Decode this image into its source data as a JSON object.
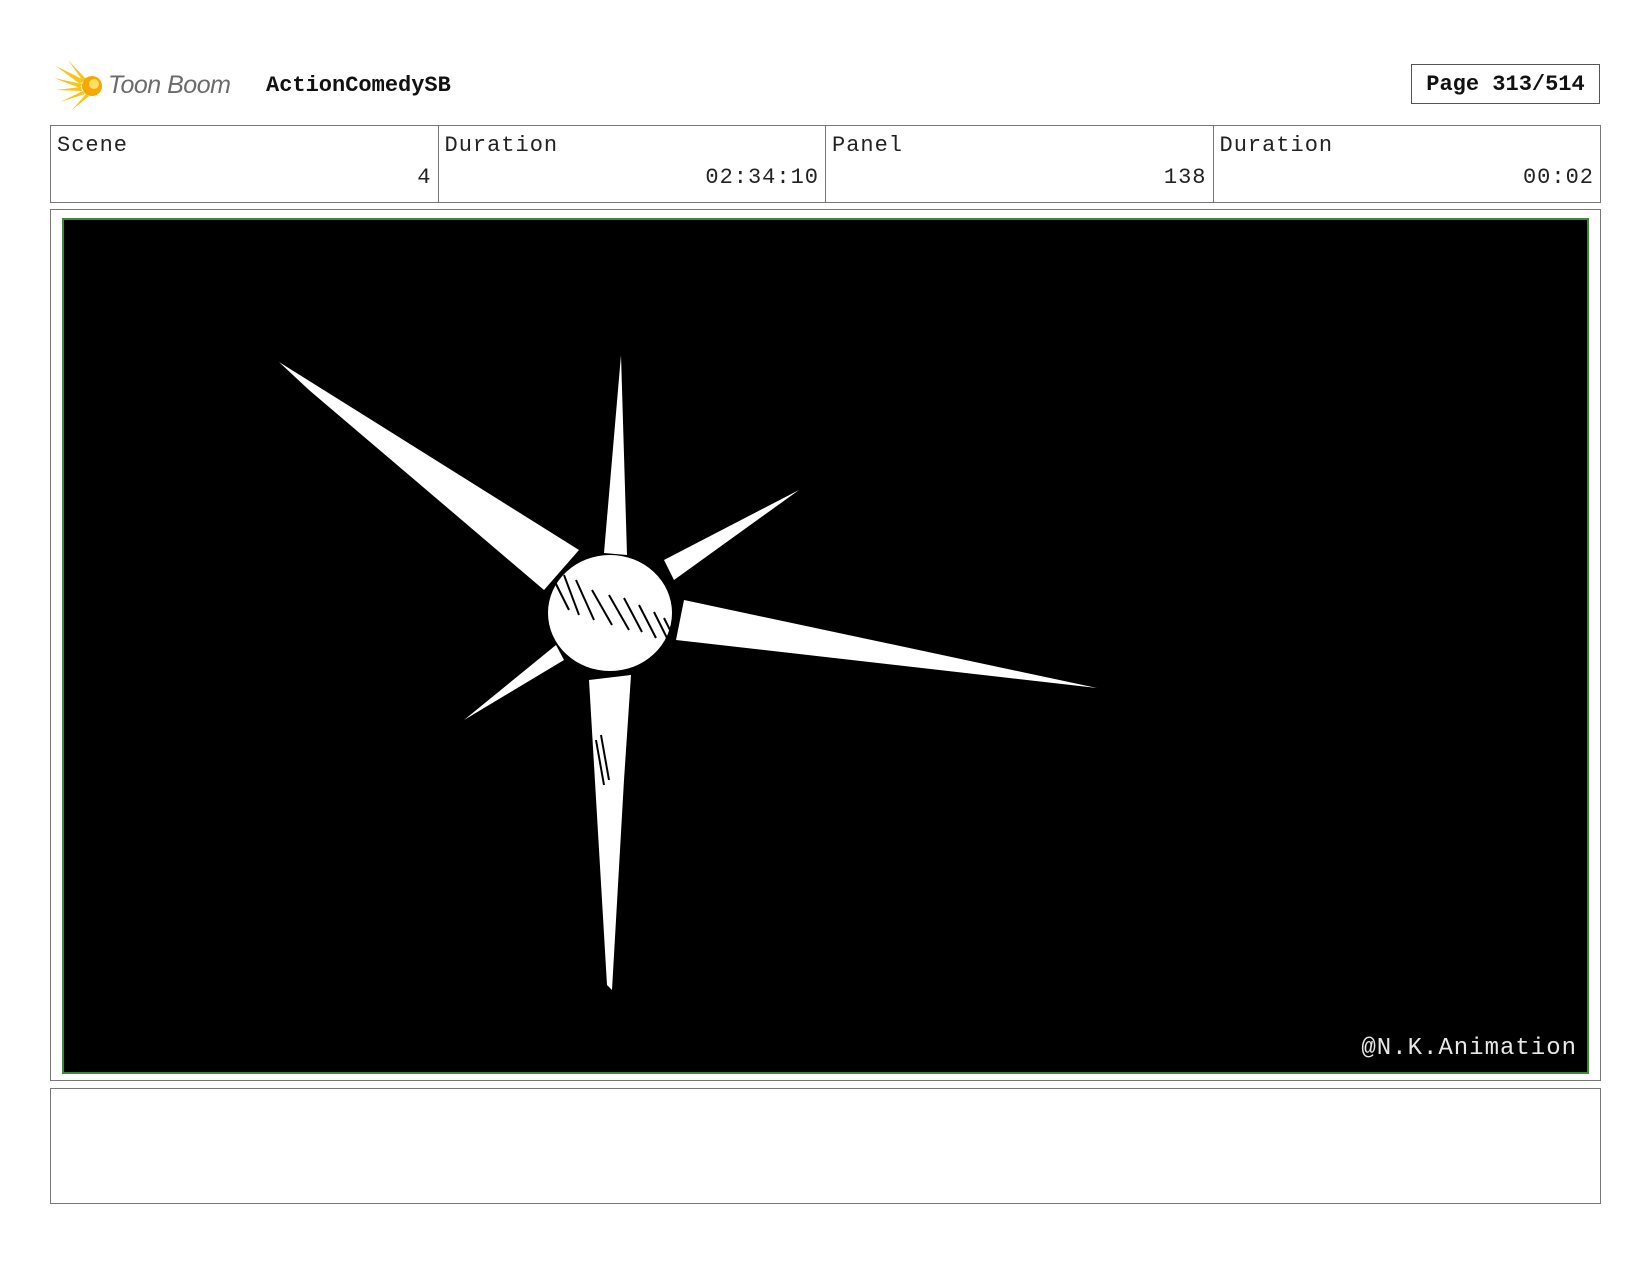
{
  "header": {
    "brand": "Toon Boom",
    "project": "ActionComedySB",
    "page_label": "Page 313/514",
    "logo_icon": "toon-boom-burst-logo"
  },
  "info": {
    "scene_label": "Scene",
    "scene_value": "4",
    "scene_duration_label": "Duration",
    "scene_duration_value": "02:34:10",
    "panel_label": "Panel",
    "panel_value": "138",
    "panel_duration_label": "Duration",
    "panel_duration_value": "00:02"
  },
  "panel": {
    "watermark": "@N.K.Animation",
    "frame_color": "#3a8a3a",
    "background_color": "#000000",
    "drawing_color": "#ffffff"
  },
  "notes": {
    "text": ""
  }
}
